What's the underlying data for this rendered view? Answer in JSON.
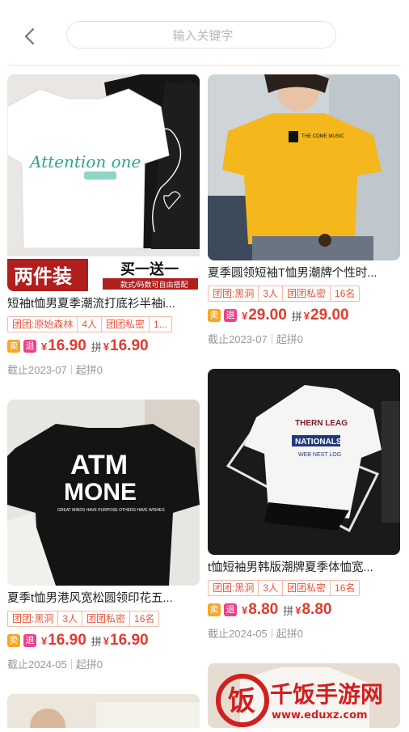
{
  "search": {
    "placeholder": "输入关键字"
  },
  "products": [
    {
      "image_text": {
        "banner_left": "两件装",
        "banner_right": "买一送一",
        "banner_sub": "款式/码数可自由搭配",
        "print": "Attention one"
      },
      "title": "短袖t恤男夏季潮流打底衫半袖i...",
      "tags": [
        "团团:原始森林",
        "4人",
        "团团私密",
        "1..."
      ],
      "sell_badge": "卖",
      "return_badge": "退",
      "currency": "¥",
      "price": "16.90",
      "pin_label": "拼",
      "pin_price": "16.90",
      "deadline": "截止2023-07",
      "min": "起拼0"
    },
    {
      "image_text": {
        "print": "THE COME MUSIC"
      },
      "title": "夏季圆领短袖T恤男潮牌个性时...",
      "tags": [
        "团团:黑洞",
        "3人",
        "团团私密",
        "16名"
      ],
      "sell_badge": "卖",
      "return_badge": "退",
      "currency": "¥",
      "price": "29.00",
      "pin_label": "拼",
      "pin_price": "29.00",
      "deadline": "截止2023-07",
      "min": "起拼0"
    },
    {
      "image_text": {
        "print1": "ATM",
        "print2": "MONE",
        "print3": "GREAT MINDS HAVE PURPOSE OTHERS HAVE WISHES"
      },
      "title": "夏季t恤男港风宽松圆领印花五...",
      "tags": [
        "团团:黑洞",
        "3人",
        "团团私密",
        "16名"
      ],
      "sell_badge": "卖",
      "return_badge": "退",
      "currency": "¥",
      "price": "16.90",
      "pin_label": "拼",
      "pin_price": "16.90",
      "deadline": "截止2024-05",
      "min": "起拼0"
    },
    {
      "image_text": {
        "print1": "THERN LEAG",
        "print2": "NATIONALS",
        "print3": "WEB NEST LOG"
      },
      "title": "t恤短袖男韩版潮牌夏季体恤宽...",
      "tags": [
        "团团:黑洞",
        "3人",
        "团团私密",
        "16名"
      ],
      "sell_badge": "卖",
      "return_badge": "退",
      "currency": "¥",
      "price": "8.80",
      "pin_label": "拼",
      "pin_price": "8.80",
      "deadline": "截止2024-05",
      "min": "起拼0"
    }
  ],
  "watermark": {
    "text": "千饭手游网",
    "url": "www.eduxz.com"
  },
  "colors": {
    "price": "#e23b2e",
    "tag": "#e8563b",
    "sell": "#f5a623",
    "return": "#e9438a"
  }
}
